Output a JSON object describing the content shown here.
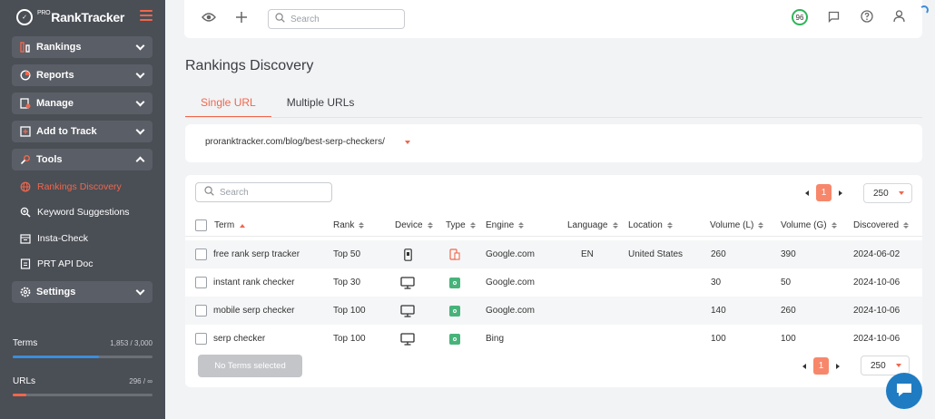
{
  "app": {
    "logo_small": "PRO",
    "logo_name": "RankTracker"
  },
  "sidebar": {
    "nav": [
      {
        "label": "Rankings",
        "icon": "bar-chart-icon",
        "expanded": false
      },
      {
        "label": "Reports",
        "icon": "pie-chart-icon",
        "expanded": false
      },
      {
        "label": "Manage",
        "icon": "gear-doc-icon",
        "expanded": false
      },
      {
        "label": "Add to Track",
        "icon": "plus-square-icon",
        "expanded": false
      },
      {
        "label": "Tools",
        "icon": "wrench-icon",
        "expanded": true
      },
      {
        "label": "Settings",
        "icon": "gear-icon",
        "expanded": false
      }
    ],
    "tools": [
      {
        "label": "Rankings Discovery",
        "icon": "globe-icon",
        "active": true
      },
      {
        "label": "Keyword Suggestions",
        "icon": "magnifier-plus-icon",
        "active": false
      },
      {
        "label": "Insta-Check",
        "icon": "calendar-icon",
        "active": false
      },
      {
        "label": "PRT API Doc",
        "icon": "code-doc-icon",
        "active": false
      }
    ],
    "usage": [
      {
        "name": "Terms",
        "value": "1,853 / 3,000",
        "fraction": 0.62,
        "color": "#3c8ddc"
      },
      {
        "name": "URLs",
        "value": "296 / ∞",
        "fraction": 0.1,
        "color": "#f0674d"
      }
    ]
  },
  "topbar": {
    "search_placeholder": "Search",
    "score": "96"
  },
  "page": {
    "title": "Rankings Discovery",
    "tabs": [
      {
        "label": "Single URL",
        "active": true
      },
      {
        "label": "Multiple URLs",
        "active": false
      }
    ],
    "url_value": "proranktracker.com/blog/best-serp-checkers/"
  },
  "table": {
    "search_placeholder": "Search",
    "current_page": "1",
    "per_page": "250",
    "columns": [
      "Term",
      "Rank",
      "Device",
      "Type",
      "Engine",
      "Language",
      "Location",
      "Volume (L)",
      "Volume (G)",
      "Discovered"
    ],
    "rows": [
      {
        "term": "free rank serp tracker",
        "rank": "Top 50",
        "device": "mobile",
        "type": "mobile",
        "engine": "Google.com",
        "language": "EN",
        "location": "United States",
        "vol_l": "260",
        "vol_g": "390",
        "discovered": "2024-06-02"
      },
      {
        "term": "instant rank checker",
        "rank": "Top 30",
        "device": "desktop",
        "type": "organic",
        "engine": "Google.com",
        "language": "",
        "location": "",
        "vol_l": "30",
        "vol_g": "50",
        "discovered": "2024-10-06"
      },
      {
        "term": "mobile serp checker",
        "rank": "Top 100",
        "device": "desktop",
        "type": "organic",
        "engine": "Google.com",
        "language": "",
        "location": "",
        "vol_l": "140",
        "vol_g": "260",
        "discovered": "2024-10-06"
      },
      {
        "term": "serp checker",
        "rank": "Top 100",
        "device": "desktop",
        "type": "organic",
        "engine": "Bing",
        "language": "",
        "location": "",
        "vol_l": "100",
        "vol_g": "100",
        "discovered": "2024-10-06"
      }
    ],
    "selection_button": "No Terms selected"
  },
  "colors": {
    "accent": "#f0674d",
    "sidebar_bg": "#4a4e55",
    "sidebar_btn": "#5a5e66",
    "chat": "#1f7cc2"
  }
}
